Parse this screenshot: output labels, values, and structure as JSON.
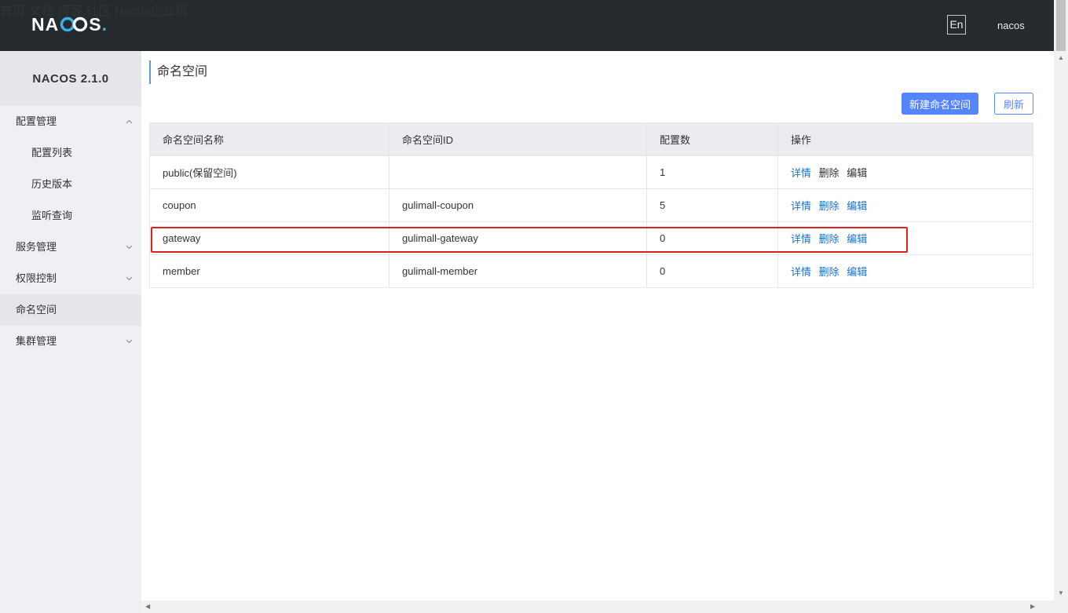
{
  "brand": {
    "logo_text_left": "N",
    "logo_text_mid_a": "A",
    "logo_text_right": "S",
    "logo_dot": "."
  },
  "nav": {
    "items": [
      "首页",
      "文档",
      "博客",
      "社区",
      "Nacos企业版"
    ],
    "lang": "En",
    "user": "nacos"
  },
  "sidebar": {
    "title": "NACOS 2.1.0",
    "items": [
      {
        "label": "配置管理",
        "icon": "chevron-up-icon"
      },
      {
        "label": "配置列表"
      },
      {
        "label": "历史版本"
      },
      {
        "label": "监听查询"
      },
      {
        "label": "服务管理",
        "icon": "chevron-down-icon"
      },
      {
        "label": "权限控制",
        "icon": "chevron-down-icon"
      },
      {
        "label": "命名空间"
      },
      {
        "label": "集群管理",
        "icon": "chevron-down-icon"
      }
    ]
  },
  "main": {
    "title": "命名空间",
    "new_button": "新建命名空间",
    "refresh_button": "刷新",
    "columns": [
      "命名空间名称",
      "命名空间ID",
      "配置数",
      "操作"
    ],
    "rows": [
      {
        "name": "public(保留空间)",
        "id": "",
        "count": "1"
      },
      {
        "name": "coupon",
        "id": "gulimall-coupon",
        "count": "5"
      },
      {
        "name": "gateway",
        "id": "gulimall-gateway",
        "count": "0"
      },
      {
        "name": "member",
        "id": "gulimall-member",
        "count": "0"
      }
    ],
    "actions": {
      "detail": "详情",
      "delete": "删除",
      "edit": "编辑"
    }
  },
  "colors": {
    "topbar": "#252a2f",
    "primary": "#5584ff",
    "link": "#1c70c9",
    "highlight": "#e02020"
  }
}
